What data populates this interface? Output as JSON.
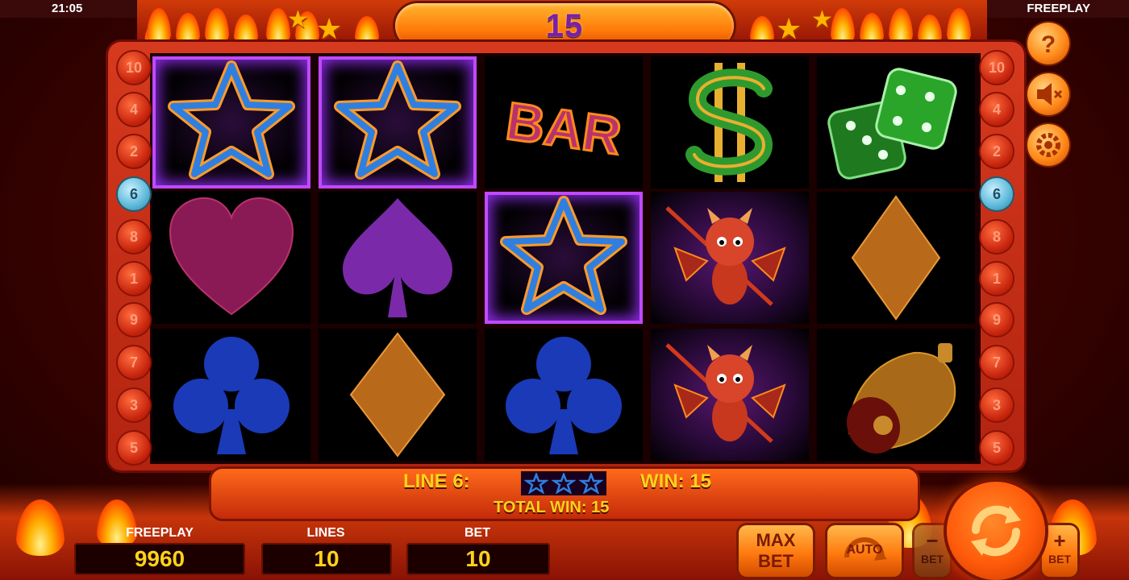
{
  "status": {
    "time": "21:05",
    "mode": "FREEPLAY"
  },
  "header": {
    "win_amount": "15"
  },
  "lines_left": [
    "10",
    "4",
    "2",
    "6",
    "8",
    "1",
    "9",
    "7",
    "3",
    "5"
  ],
  "lines_right": [
    "10",
    "4",
    "2",
    "6",
    "8",
    "1",
    "9",
    "7",
    "3",
    "5"
  ],
  "active_line": "6",
  "reels": [
    [
      "star",
      "star",
      "bar",
      "dollar",
      "dice"
    ],
    [
      "heart",
      "spade",
      "star",
      "devil",
      "diamond"
    ],
    [
      "club",
      "diamond",
      "club",
      "devil",
      "bell"
    ]
  ],
  "bar_symbol_text": "BAR",
  "info": {
    "line_text": "LINE 6:",
    "win_text": "WIN: 15",
    "total_win_text": "TOTAL WIN: 15",
    "win_symbols": [
      "star",
      "star",
      "star"
    ]
  },
  "counters": {
    "balance": {
      "label": "FREEPLAY",
      "value": "9960"
    },
    "lines": {
      "label": "LINES",
      "value": "10"
    },
    "bet": {
      "label": "BET",
      "value": "10"
    }
  },
  "buttons": {
    "max_bet_line1": "MAX",
    "max_bet_line2": "BET",
    "auto": "AUTO",
    "bet_minus": "BET",
    "bet_plus": "BET"
  },
  "side_buttons": [
    "help-icon",
    "mute-icon",
    "settings-icon"
  ],
  "colors": {
    "accent_gold": "#ffd21a",
    "win_purple": "#c04aff",
    "active_line": "#5bb8d8"
  }
}
